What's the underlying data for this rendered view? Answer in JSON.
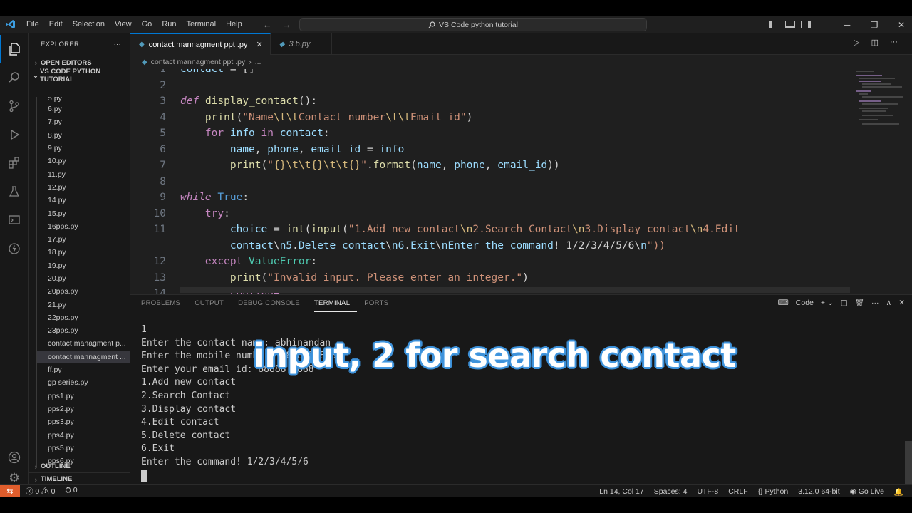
{
  "titlebar": {
    "menu": [
      "File",
      "Edit",
      "Selection",
      "View",
      "Go",
      "Run",
      "Terminal",
      "Help"
    ],
    "search_label": "VS Code python tutorial"
  },
  "sidebar": {
    "title": "EXPLORER",
    "open_editors": "OPEN EDITORS",
    "folder": "VS CODE PYTHON TUTORIAL",
    "files": [
      "5.py",
      "6.py",
      "7.py",
      "8.py",
      "9.py",
      "10.py",
      "11.py",
      "12.py",
      "14.py",
      "15.py",
      "16pps.py",
      "17.py",
      "18.py",
      "19.py",
      "20.py",
      "20pps.py",
      "21.py",
      "22pps.py",
      "23pps.py",
      "contact managment p...",
      "contact mannagment ...",
      "ff.py",
      "gp series.py",
      "pps1.py",
      "pps2.py",
      "pps3.py",
      "pps4.py",
      "pps5.py",
      "pps6.py"
    ],
    "outline": "OUTLINE",
    "timeline": "TIMELINE"
  },
  "editor": {
    "tabs": [
      {
        "label": "contact mannagment ppt .py"
      },
      {
        "label": "3.b.py"
      }
    ],
    "breadcrumb": "contact mannagment ppt .py",
    "lines": [
      {
        "n": "1",
        "text": "contact = []"
      },
      {
        "n": "2",
        "text": ""
      },
      {
        "n": "3",
        "text": "def display_contact():"
      },
      {
        "n": "4",
        "text": "    print(\"Name\\t\\tContact number\\t\\tEmail id\")"
      },
      {
        "n": "5",
        "text": "    for info in contact:"
      },
      {
        "n": "6",
        "text": "        name, phone, email_id = info"
      },
      {
        "n": "7",
        "text": "        print(\"{}\\t\\t{}\\t\\t{}\".format(name, phone, email_id))"
      },
      {
        "n": "8",
        "text": ""
      },
      {
        "n": "9",
        "text": "while True:"
      },
      {
        "n": "10",
        "text": "    try:"
      },
      {
        "n": "11",
        "text": "        choice = int(input(\"1.Add new contact\\n2.Search Contact\\n3.Display contact\\n4.Edit"
      },
      {
        "n": "",
        "text": "        contact\\n5.Delete contact\\n6.Exit\\nEnter the command! 1/2/3/4/5/6\\n\"))"
      },
      {
        "n": "12",
        "text": "    except ValueError:"
      },
      {
        "n": "13",
        "text": "        print(\"Invalid input. Please enter an integer.\")"
      },
      {
        "n": "14",
        "text": "        continue"
      }
    ]
  },
  "panel": {
    "tabs": [
      "PROBLEMS",
      "OUTPUT",
      "DEBUG CONSOLE",
      "TERMINAL",
      "PORTS"
    ],
    "active_tab": "TERMINAL",
    "shell_label": "Code",
    "terminal_lines": [
      "1",
      "Enter the contact name: abhinandan",
      "Enter the mobile number: 8888888888",
      "Enter your email id: 88888 8888",
      "1.Add new contact",
      "2.Search Contact",
      "3.Display contact",
      "4.Edit contact",
      "5.Delete contact",
      "6.Exit",
      "Enter the command! 1/2/3/4/5/6"
    ]
  },
  "caption": "input, 2 for search contact",
  "statusbar": {
    "errors": "0",
    "warnings": "0",
    "ports": "0",
    "position": "Ln 14, Col 17",
    "spaces": "Spaces: 4",
    "encoding": "UTF-8",
    "eol": "CRLF",
    "language": "Python",
    "interpreter": "3.12.0 64-bit",
    "golive": "Go Live"
  },
  "colors": {
    "accent": "#0078d4",
    "keyword": "#c586c0",
    "function": "#dcdcaa",
    "string": "#ce9178",
    "variable": "#9cdcfe",
    "type": "#4ec9b0",
    "remote": "#e05d2c"
  }
}
